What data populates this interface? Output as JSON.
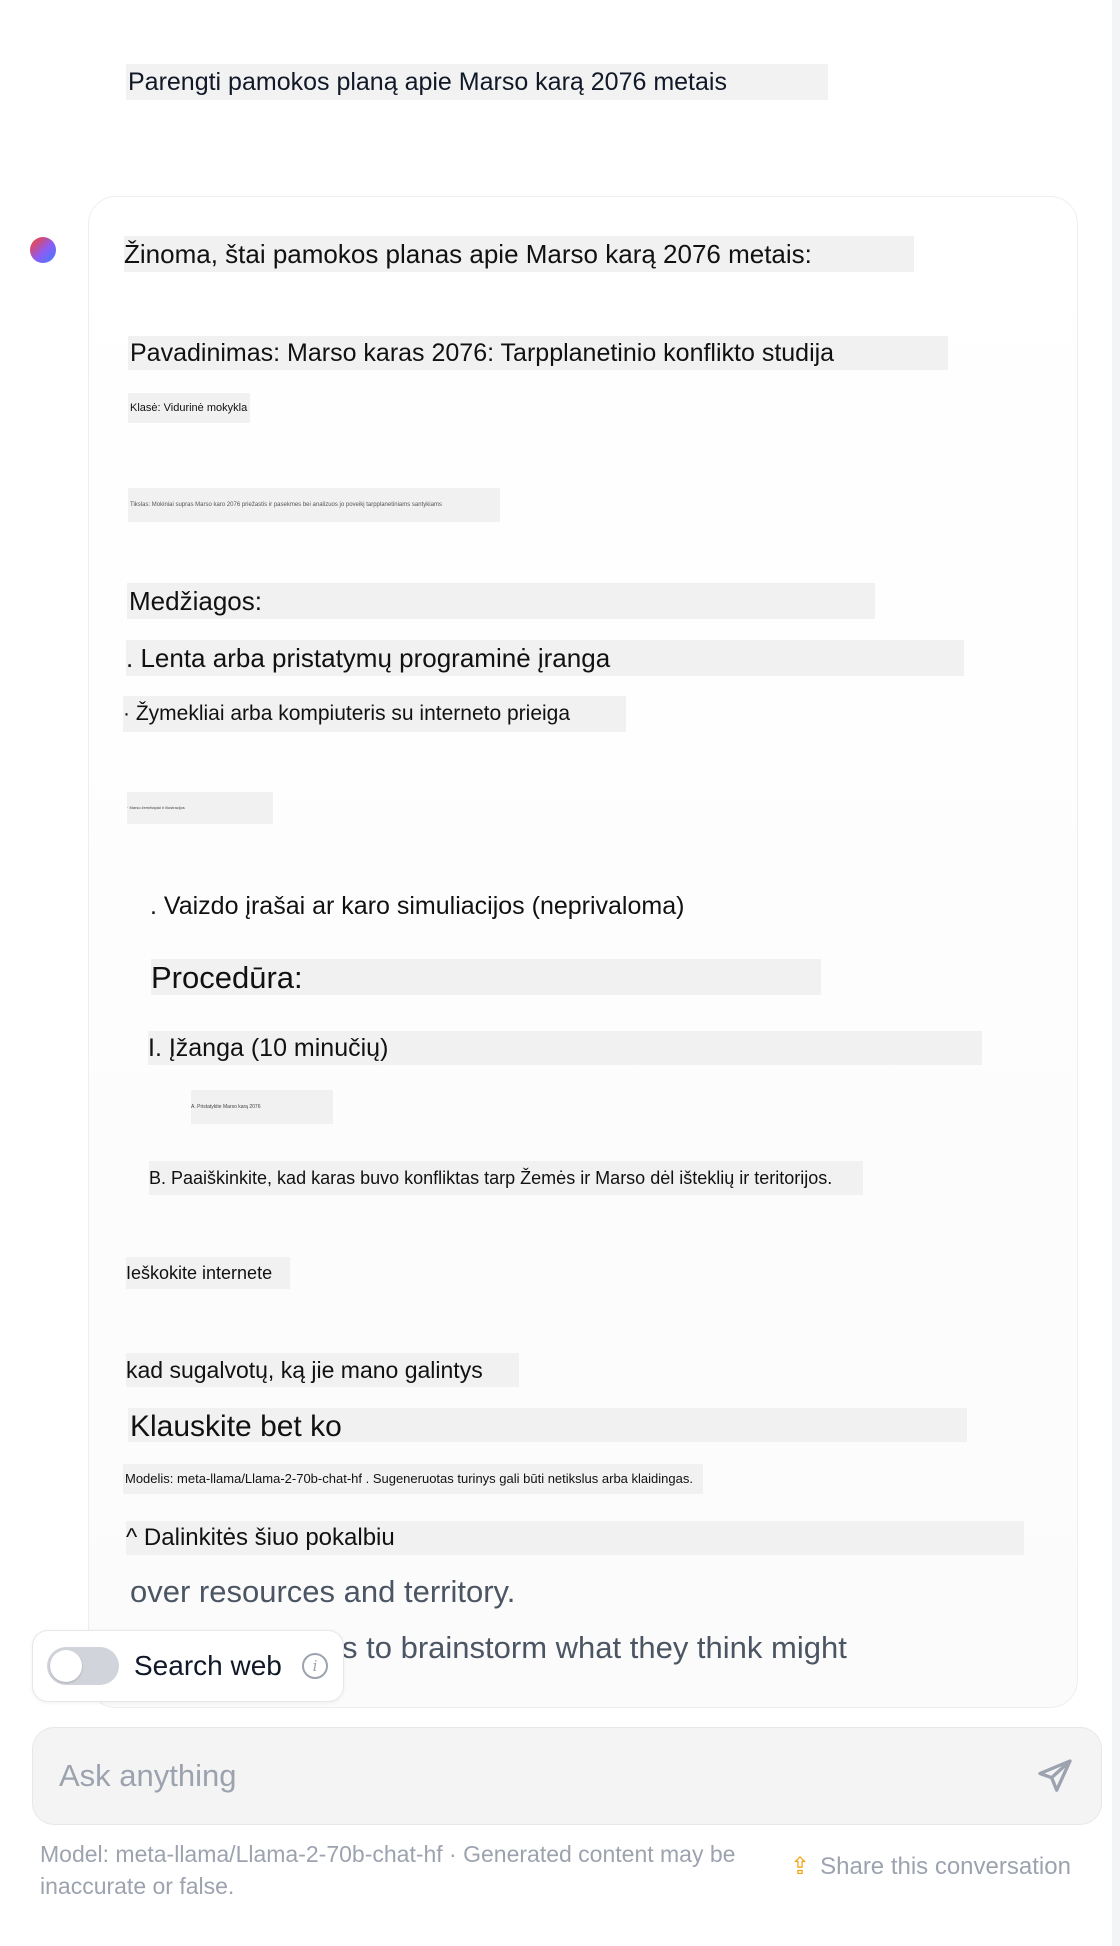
{
  "conversation": {
    "user_message": "Parengti pamokos planą apie Marso karą 2076 metais",
    "assistant": {
      "intro": "Žinoma, štai pamokos planas apie Marso karą 2076 metais:",
      "title_line": "Pavadinimas: Marso karas 2076: Tarpplanetinio konflikto studija",
      "grade_line": "Klasė: Vidurinė mokykla",
      "objective_line": "Tikslas: Mokiniai supras Marso karo 2076 priežastis ir pasekmes bei analizuos jo poveikį tarpplanetiniams santykiams",
      "materials_heading": "Medžiagos:",
      "material_1": ". Lenta arba pristatymų programinė įranga",
      "material_2": "· Žymekliai arba kompiuteris su interneto prieiga",
      "material_3": "· Marso žemėlapiai ir iliustracijos",
      "material_4": ". Vaizdo įrašai ar karo simuliacijos (neprivaloma)",
      "procedure_heading": "Procedūra:",
      "intro_section": "I. Įžanga (10 minučių)",
      "intro_item_a": "A. Pristatykite Marso karą 2076",
      "intro_item_b": "B. Paaiškinkite, kad karas buvo konfliktas tarp Žemės ir Marso dėl išteklių ir teritorijos.",
      "search_prompt": "Ieškokite internete",
      "brainstorm_line": "kad sugalvotų, ką jie mano galintys",
      "ask_anything": "Klauskite bet ko",
      "model_note": "Modelis: meta-llama/Llama-2-70b-chat-hf . Sugeneruotas turinys gali būti netikslus arba klaidingas.",
      "share_line": "^ Dalinkitės šiuo pokalbiu",
      "english_line_1": "over resources and territory.",
      "english_line_2": "s to brainstorm what they think might"
    }
  },
  "search_toggle": {
    "label": "Search web",
    "enabled": false
  },
  "composer": {
    "placeholder": "Ask anything"
  },
  "footer": {
    "disclaimer": "Model: meta-llama/Llama-2-70b-chat-hf · Generated content may be inaccurate or false.",
    "share_label": "Share this conversation"
  },
  "icons": {
    "avatar": "assistant-avatar-icon",
    "info": "info-icon",
    "send": "send-icon",
    "share": "share-upload-icon"
  },
  "colors": {
    "accent": "#f59e0b",
    "text_muted": "#9ca3af",
    "highlight": "#f1f1f1"
  }
}
